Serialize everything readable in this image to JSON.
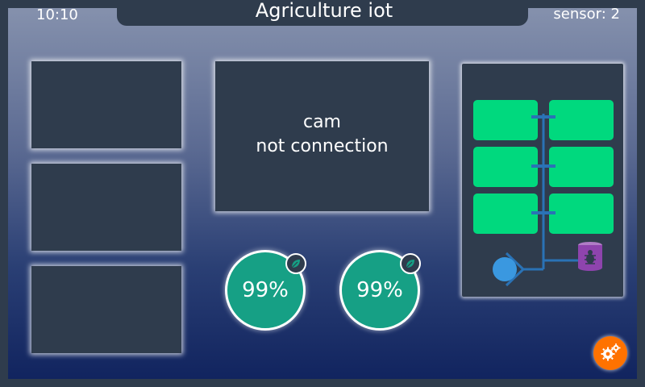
{
  "header": {
    "title": "Agriculture iot",
    "time": "10:10",
    "sensor_label": "sensor: 2"
  },
  "camera": {
    "line1": "cam",
    "line2": "not connection"
  },
  "gauges": [
    {
      "value": "99%",
      "icon": "leaf-icon"
    },
    {
      "value": "99%",
      "icon": "leaf-icon"
    }
  ],
  "farm_map": {
    "beds_per_side": 3,
    "icons": [
      "water-pump-icon",
      "pest-control-icon"
    ]
  },
  "settings": {
    "icon": "gears-icon"
  },
  "colors": {
    "panel": "#2f3c4d",
    "bed_green": "#00d97e",
    "gauge_teal": "#16a085",
    "pipe_blue": "#2a72b5",
    "pump_blue": "#3a98e0",
    "pest_purple": "#8e44ad",
    "settings_orange": "#ff7200"
  }
}
